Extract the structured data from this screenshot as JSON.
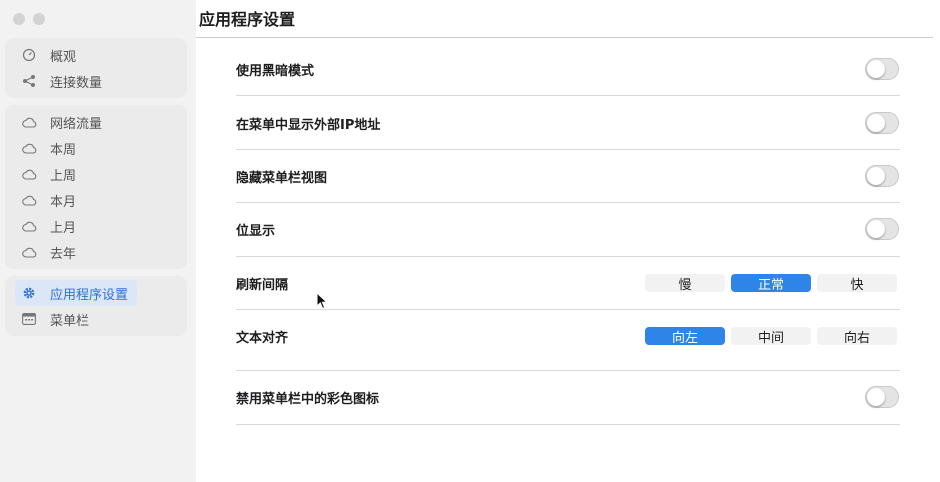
{
  "sidebar": {
    "groups": [
      [
        {
          "label": "概观",
          "icon": "gauge-icon"
        },
        {
          "label": "连接数量",
          "icon": "share-icon"
        }
      ],
      [
        {
          "label": "网络流量",
          "icon": "cloud-icon"
        },
        {
          "label": "本周",
          "icon": "cloud-icon"
        },
        {
          "label": "上周",
          "icon": "cloud-icon"
        },
        {
          "label": "本月",
          "icon": "cloud-icon"
        },
        {
          "label": "上月",
          "icon": "cloud-icon"
        },
        {
          "label": "去年",
          "icon": "cloud-icon"
        }
      ],
      [
        {
          "label": "应用程序设置",
          "icon": "gear-icon",
          "selected": true
        },
        {
          "label": "菜单栏",
          "icon": "menubar-icon"
        }
      ]
    ]
  },
  "main": {
    "title": "应用程序设置",
    "settings": {
      "dark_mode": {
        "label": "使用黑暗模式",
        "enabled": false
      },
      "external_ip": {
        "label": "在菜单中显示外部IP地址",
        "enabled": false
      },
      "hide_menubar_view": {
        "label": "隐藏菜单栏视图",
        "enabled": false
      },
      "bit_display": {
        "label": "位显示",
        "enabled": false
      },
      "refresh_interval": {
        "label": "刷新间隔",
        "options": [
          "慢",
          "正常",
          "快"
        ],
        "selected": "正常"
      },
      "text_align": {
        "label": "文本对齐",
        "options": [
          "向左",
          "中间",
          "向右"
        ],
        "selected": "向左"
      },
      "disable_color_icons": {
        "label": "禁用菜单栏中的彩色图标",
        "enabled": false
      }
    }
  },
  "colors": {
    "accent": "#2f84e8",
    "selected_sidebar_text": "#2f72d6",
    "selected_sidebar_bg": "#dbe6f6"
  }
}
